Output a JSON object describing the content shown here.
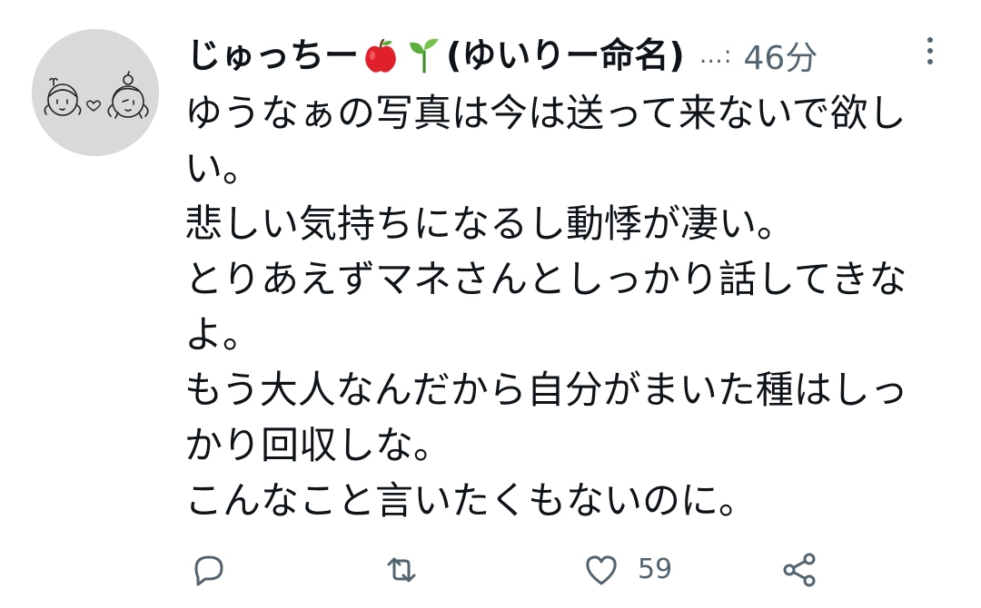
{
  "tweet": {
    "author": {
      "name_part1": "じゅっちー",
      "name_part2": "(ゆいりー命名)",
      "emojis": [
        "apple-emoji",
        "seedling-emoji"
      ],
      "avatar": "drawn-girls-avatar"
    },
    "dots": "…:",
    "time": "46分",
    "text_lines": [
      "ゆうなぁの写真は今は送って来ないで欲し",
      "い。",
      "悲しい気持ちになるし動悸が凄い。",
      "とりあえずマネさんとしっかり話してきな",
      "よ。",
      "もう大人なんだから自分がまいた種はしっ",
      "かり回収しな。",
      "こんなこと言いたくもないのに。"
    ],
    "actions": {
      "reply_icon": "reply-icon",
      "retweet_icon": "retweet-icon",
      "like_icon": "heart-icon",
      "like_count": "59",
      "share_icon": "share-icon"
    },
    "colors": {
      "text": "#0f1419",
      "secondary": "#536471",
      "apple": "#e0202a",
      "leaf": "#5cae3a"
    }
  }
}
